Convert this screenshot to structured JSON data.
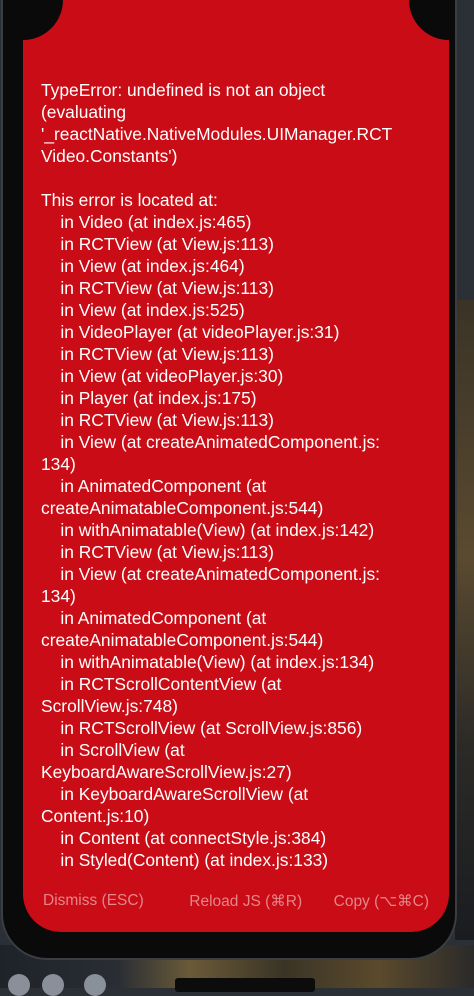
{
  "error": {
    "lines": [
      "TypeError: undefined is not an object",
      "(evaluating",
      "'_reactNative.NativeModules.UIManager.RCT",
      "Video.Constants')",
      "",
      "This error is located at:",
      "    in Video (at index.js:465)",
      "    in RCTView (at View.js:113)",
      "    in View (at index.js:464)",
      "    in RCTView (at View.js:113)",
      "    in View (at index.js:525)",
      "    in VideoPlayer (at videoPlayer.js:31)",
      "    in RCTView (at View.js:113)",
      "    in View (at videoPlayer.js:30)",
      "    in Player (at index.js:175)",
      "    in RCTView (at View.js:113)",
      "    in View (at createAnimatedComponent.js:",
      "134)",
      "    in AnimatedComponent (at",
      "createAnimatableComponent.js:544)",
      "    in withAnimatable(View) (at index.js:142)",
      "    in RCTView (at View.js:113)",
      "    in View (at createAnimatedComponent.js:",
      "134)",
      "    in AnimatedComponent (at",
      "createAnimatableComponent.js:544)",
      "    in withAnimatable(View) (at index.js:134)",
      "    in RCTScrollContentView (at",
      "ScrollView.js:748)",
      "    in RCTScrollView (at ScrollView.js:856)",
      "    in ScrollView (at",
      "KeyboardAwareScrollView.js:27)",
      "    in KeyboardAwareScrollView (at",
      "Content.js:10)",
      "    in Content (at connectStyle.js:384)",
      "    in Styled(Content) (at index.js:133)"
    ]
  },
  "footer": {
    "dismiss_label": "Dismiss (ESC)",
    "reload_label": "Reload JS (⌘R)",
    "copy_label": "Copy (⌥⌘C)"
  },
  "colors": {
    "error_background": "#c90c15",
    "footer_text": "#e6858a"
  }
}
